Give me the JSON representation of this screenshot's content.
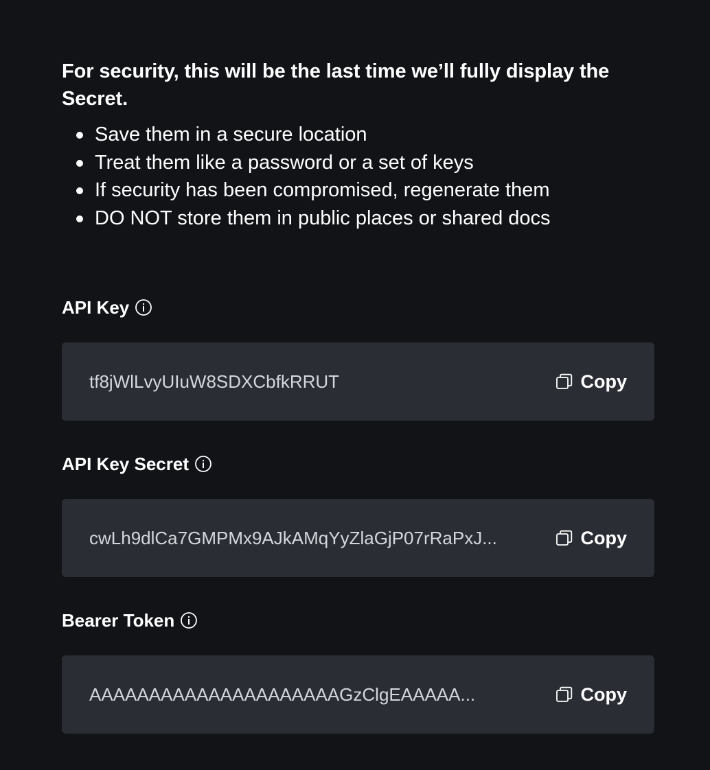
{
  "warning": {
    "title": "For security, this will be the last time we’ll fully display the Secret.",
    "bullets": [
      "Save them in a secure location",
      "Treat them like a password or a set of keys",
      "If security has been compromised, regenerate them",
      "DO NOT store them in public places or shared docs"
    ]
  },
  "fields": {
    "api_key": {
      "label": "API Key",
      "value": "tf8jWlLvyUIuW8SDXCbfkRRUT",
      "copy_label": "Copy",
      "info_icon": "info-icon",
      "copy_icon": "copy-icon"
    },
    "api_key_secret": {
      "label": "API Key Secret",
      "value": "cwLh9dlCa7GMPMx9AJkAMqYyZlaGjP07rRaPxJ...",
      "copy_label": "Copy",
      "info_icon": "info-icon",
      "copy_icon": "copy-icon"
    },
    "bearer_token": {
      "label": "Bearer Token",
      "value": "AAAAAAAAAAAAAAAAAAAAAGzClgEAAAAA...",
      "copy_label": "Copy",
      "info_icon": "info-icon",
      "copy_icon": "copy-icon"
    }
  },
  "colors": {
    "background": "#111317",
    "field_background": "#2a2d33",
    "text": "#ffffff",
    "value_text": "#d4d7dc"
  }
}
